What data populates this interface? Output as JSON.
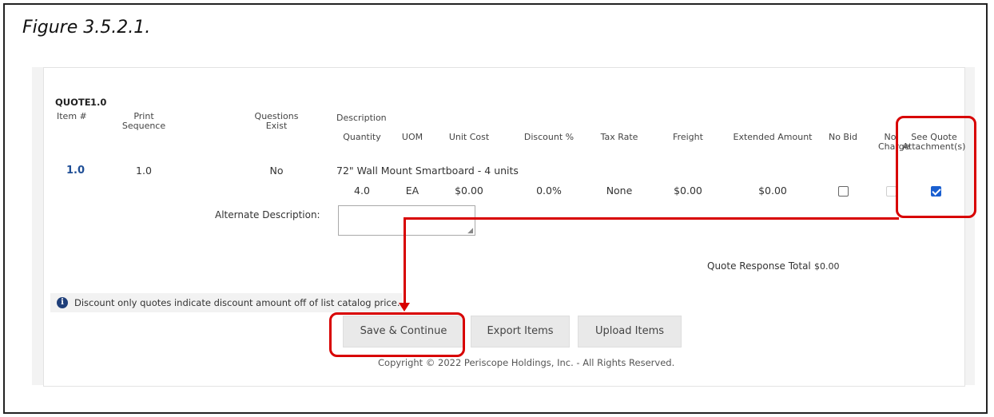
{
  "figure": {
    "caption": "Figure 3.5.2.1."
  },
  "quote": {
    "label": "QUOTE",
    "number": "1.0"
  },
  "columns": {
    "item": "Item #",
    "print_sequence_line1": "Print",
    "print_sequence_line2": "Sequence",
    "questions_line1": "Questions",
    "questions_line2": "Exist",
    "description": "Description",
    "quantity": "Quantity",
    "uom": "UOM",
    "unit_cost": "Unit Cost",
    "discount": "Discount %",
    "tax_rate": "Tax Rate",
    "freight": "Freight",
    "extended_amount": "Extended Amount",
    "no_bid": "No Bid",
    "no_charge_line1": "No",
    "no_charge_line2": "Charge",
    "see_quote_line1": "See Quote",
    "see_quote_line2": "Attachment(s)"
  },
  "row": {
    "item": "1.0",
    "print_sequence": "1.0",
    "questions_exist": "No",
    "description": "72\" Wall Mount Smartboard - 4 units",
    "quantity": "4.0",
    "uom": "EA",
    "unit_cost": "$0.00",
    "discount": "0.0%",
    "tax_rate": "None",
    "freight": "$0.00",
    "extended_amount": "$0.00",
    "no_bid_checked": false,
    "no_charge_checked": false,
    "no_charge_disabled": true,
    "see_quote_attachments_checked": true
  },
  "alternate_description": {
    "label": "Alternate Description:",
    "value": ""
  },
  "totals": {
    "label": "Quote Response Total",
    "value": "$0.00"
  },
  "info": {
    "text": "Discount only quotes indicate discount amount off of list catalog price."
  },
  "buttons": {
    "save": "Save & Continue",
    "export": "Export Items",
    "upload": "Upload Items"
  },
  "footer": {
    "copyright": "Copyright © 2022 Periscope Holdings, Inc. - All Rights Reserved."
  },
  "colors": {
    "highlight": "#d80000",
    "link": "#1f4e96",
    "checkbox": "#1a5fd0"
  }
}
